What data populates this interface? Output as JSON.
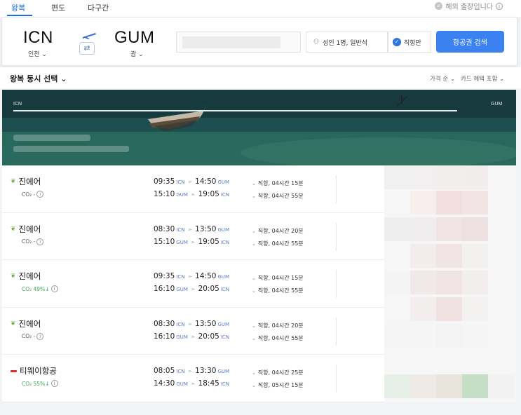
{
  "tabs": [
    {
      "label": "왕복",
      "active": true
    },
    {
      "label": "편도",
      "active": false
    },
    {
      "label": "다구간",
      "active": false
    }
  ],
  "business_trip_label": "해외 출장입니다",
  "search": {
    "origin_code": "ICN",
    "origin_city": "인천",
    "dest_code": "GUM",
    "dest_city": "괌",
    "passengers": "성인 1명, 일반석",
    "direct_only": "직항만",
    "search_button": "항공권 검색"
  },
  "sort": {
    "title": "왕복 동시 선택",
    "price_sort": "가격 순",
    "card_benefit": "카드 혜택 포함"
  },
  "banner": {
    "origin": "ICN",
    "dest": "GUM"
  },
  "results": [
    {
      "airline": "진에어",
      "logo": "jinair-leaf",
      "co2": "CO₂ -",
      "co2_green": false,
      "out": {
        "dep": "09:35",
        "dep_ap": "ICN",
        "arr": "14:50",
        "arr_ap": "GUM",
        "info": "직항, 04시간 15분"
      },
      "ret": {
        "dep": "15:10",
        "dep_ap": "GUM",
        "arr": "19:05",
        "arr_ap": "ICN",
        "info": "직항, 04시간 55분"
      }
    },
    {
      "airline": "진에어",
      "logo": "jinair-leaf",
      "co2": "CO₂ -",
      "co2_green": false,
      "out": {
        "dep": "08:30",
        "dep_ap": "ICN",
        "arr": "13:50",
        "arr_ap": "GUM",
        "info": "직항, 04시간 20분"
      },
      "ret": {
        "dep": "15:10",
        "dep_ap": "GUM",
        "arr": "19:05",
        "arr_ap": "ICN",
        "info": "직항, 04시간 55분"
      }
    },
    {
      "airline": "진에어",
      "logo": "jinair-leaf",
      "co2": "CO₂ 49%↓",
      "co2_green": true,
      "out": {
        "dep": "09:35",
        "dep_ap": "ICN",
        "arr": "14:50",
        "arr_ap": "GUM",
        "info": "직항, 04시간 15분"
      },
      "ret": {
        "dep": "16:10",
        "dep_ap": "GUM",
        "arr": "20:05",
        "arr_ap": "ICN",
        "info": "직항, 04시간 55분"
      }
    },
    {
      "airline": "진에어",
      "logo": "jinair-leaf",
      "co2": "CO₂ -",
      "co2_green": false,
      "out": {
        "dep": "08:30",
        "dep_ap": "ICN",
        "arr": "13:50",
        "arr_ap": "GUM",
        "info": "직항, 04시간 20분"
      },
      "ret": {
        "dep": "16:10",
        "dep_ap": "GUM",
        "arr": "20:05",
        "arr_ap": "ICN",
        "info": "직항, 04시간 55분"
      }
    },
    {
      "airline": "티웨이항공",
      "logo": "tway-mark",
      "co2": "CO₂ 55%↓",
      "co2_green": true,
      "out": {
        "dep": "08:05",
        "dep_ap": "ICN",
        "arr": "13:30",
        "arr_ap": "GUM",
        "info": "직항, 04시간 25분"
      },
      "ret": {
        "dep": "14:30",
        "dep_ap": "GUM",
        "arr": "18:45",
        "arr_ap": "ICN",
        "info": "직항, 05시간 15분"
      }
    }
  ],
  "colors": {
    "accent": "#1c6fe3",
    "search_button": "#3b82f0",
    "co2_green": "#3aa757",
    "airport_code": "#5b7bc7"
  }
}
